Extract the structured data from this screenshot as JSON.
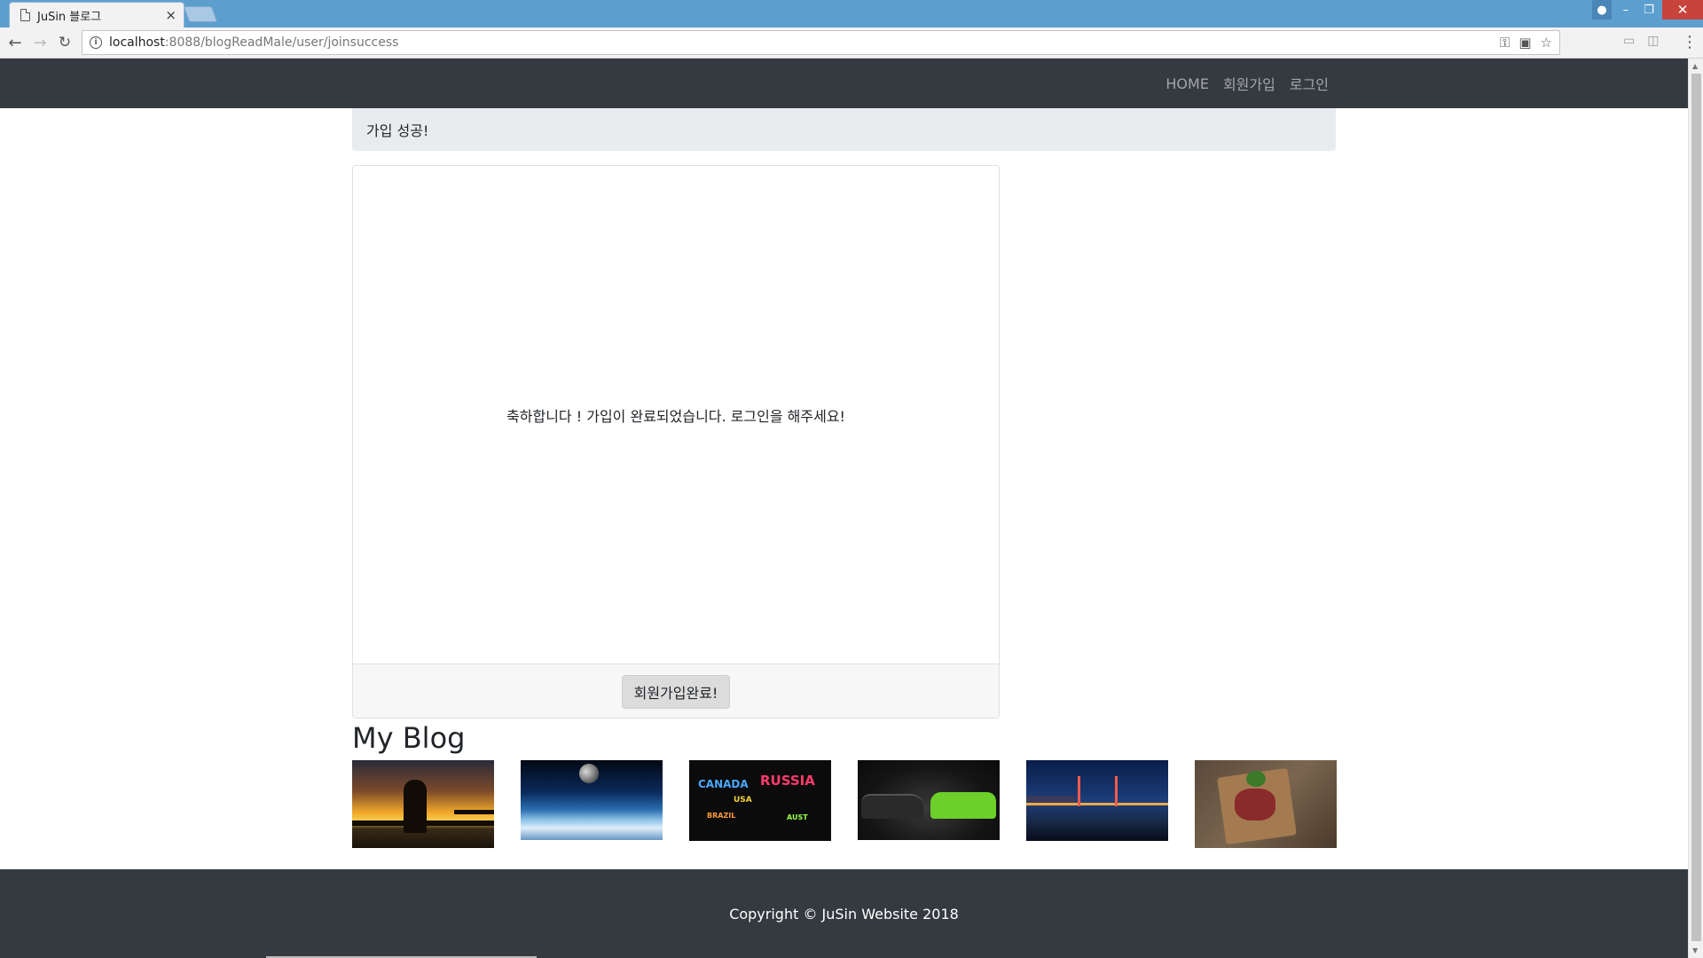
{
  "browser": {
    "tab_title": "JuSin 블로그",
    "tab_close": "×",
    "url_host": "localhost",
    "url_rest": ":8088/blogReadMale/user/joinsuccess"
  },
  "site_nav": {
    "links": [
      "HOME",
      "회원가입",
      "로그인"
    ]
  },
  "breadcrumb": "가입 성공!",
  "card": {
    "message": "축하합니다 ! 가입이 완료되었습니다. 로그인을 해주세요!",
    "button_label": "회원가입완료!"
  },
  "blog": {
    "heading": "My Blog",
    "thumbnails": [
      "sunset-couple",
      "earth-moon",
      "world-map-words",
      "muscle-cars",
      "night-bridge",
      "steak-board"
    ],
    "thumb_text": {
      "canada": "CANADA",
      "russia": "RUSSIA",
      "small1": "BRAZIL",
      "small2": "AUST",
      "small3": "USA"
    }
  },
  "footer": {
    "copyright": "Copyright © JuSin Website 2018"
  },
  "colors": {
    "titlebar": "#5c9fce",
    "navbar": "#343a40",
    "breadcrumb_bg": "#e9ecef",
    "nav_link": "rgba(255,255,255,0.55)"
  }
}
